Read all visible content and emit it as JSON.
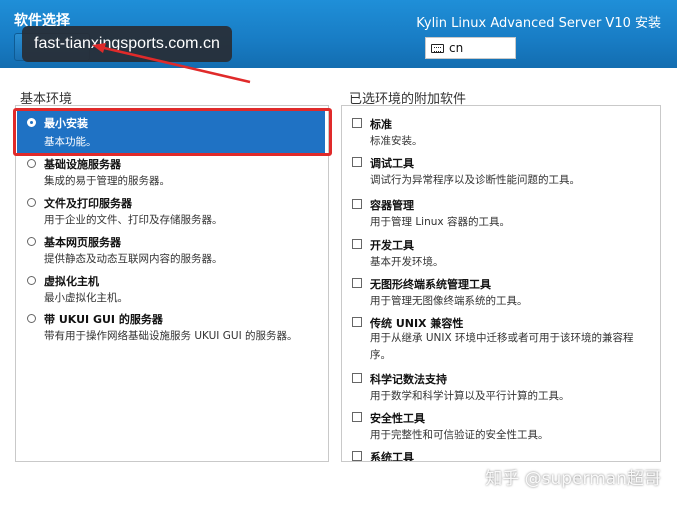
{
  "header": {
    "page_title": "软件选择",
    "product_title": "Kylin Linux Advanced Server V10 安装",
    "keyboard_layout": "cn"
  },
  "overlay": {
    "url_text": "fast-tianxingsports.com.cn"
  },
  "left": {
    "title": "基本环境",
    "items": [
      {
        "name": "最小安装",
        "desc": "基本功能。",
        "selected": true
      },
      {
        "name": "基础设施服务器",
        "desc": "集成的易于管理的服务器。",
        "selected": false
      },
      {
        "name": "文件及打印服务器",
        "desc": "用于企业的文件、打印及存储服务器。",
        "selected": false
      },
      {
        "name": "基本网页服务器",
        "desc": "提供静态及动态互联网内容的服务器。",
        "selected": false
      },
      {
        "name": "虚拟化主机",
        "desc": "最小虚拟化主机。",
        "selected": false
      },
      {
        "name": "带 UKUI GUI 的服务器",
        "desc": "带有用于操作网络基础设施服务 UKUI GUI 的服务器。",
        "selected": false
      }
    ]
  },
  "right": {
    "title": "已选环境的附加软件",
    "items": [
      {
        "name": "标准",
        "desc": "标准安装。"
      },
      {
        "name": "调试工具",
        "desc": "调试行为异常程序以及诊断性能问题的工具。"
      },
      {
        "name": "容器管理",
        "desc": "用于管理 Linux 容器的工具。"
      },
      {
        "name": "开发工具",
        "desc": "基本开发环境。"
      },
      {
        "name": "无图形终端系统管理工具",
        "desc": "用于管理无图像终端系统的工具。"
      },
      {
        "name": "传统 UNIX 兼容性",
        "desc": "用于从继承 UNIX 环境中迁移或者可用于该环境的兼容程序。"
      },
      {
        "name": "科学记数法支持",
        "desc": "用于数学和科学计算以及平行计算的工具。"
      },
      {
        "name": "安全性工具",
        "desc": "用于完整性和可信验证的安全性工具。"
      },
      {
        "name": "系统工具",
        "desc": ""
      }
    ]
  },
  "watermark": "知乎 @superman超哥",
  "colors": {
    "header_blue": "#187cc4",
    "selection_blue": "#1f72c4",
    "highlight_red": "#e02a2a"
  }
}
